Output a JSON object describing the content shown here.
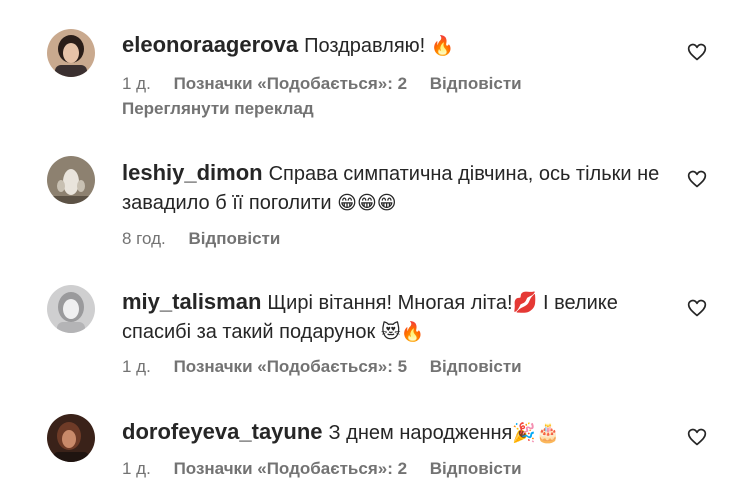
{
  "comments": [
    {
      "username": "eleonoraagerova",
      "text": "Поздравляю!",
      "emojis": "🔥",
      "time": "1 д.",
      "likes": "Позначки «Подобається»: 2",
      "reply": "Відповісти",
      "translate": "Переглянути переклад"
    },
    {
      "username": "leshiy_dimon",
      "text": "Справа симпатична дівчина, ось тільки не завадило б її поголити",
      "emojis": "😁😁😁",
      "time": "8 год.",
      "reply": "Відповісти"
    },
    {
      "username": "miy_talisman",
      "text": "Щирі вітання! Многая літа!💋 І велике спасибі за такий подарунок",
      "emojis": "😻🔥",
      "time": "1 д.",
      "likes": "Позначки «Подобається»: 5",
      "reply": "Відповісти"
    },
    {
      "username": "dorofeyeva_tayune",
      "text": "З днем народження",
      "emojis": "🎉🎂",
      "time": "1 д.",
      "likes": "Позначки «Подобається»: 2",
      "reply": "Відповісти"
    }
  ],
  "icons": {
    "like": "heart-outline-icon"
  },
  "colors": {
    "text": "#262626",
    "secondary": "#737373"
  }
}
